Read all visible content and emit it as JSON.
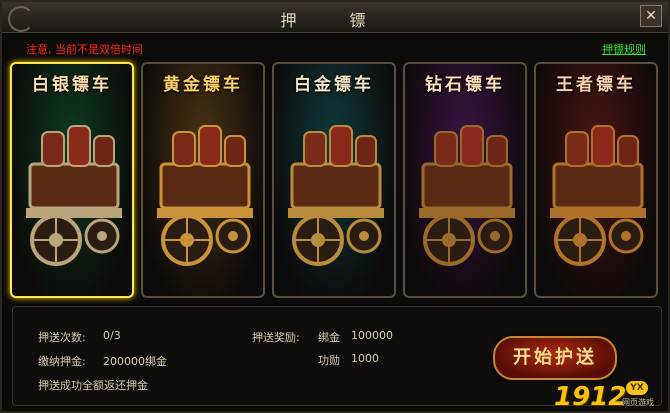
{
  "window": {
    "title": "押  镖",
    "close_label": "✕"
  },
  "notice": "注意, 当前不是双倍时间",
  "rules_link": "押镖规则",
  "cards": [
    {
      "name": "白银镖车",
      "color": "#ffe0b0",
      "bg": "#0d3a21",
      "metal": "#b9a47c",
      "selected": true
    },
    {
      "name": "黄金镖车",
      "color": "#ffd36a",
      "bg": "#4a3315",
      "metal": "#c9923b",
      "selected": false
    },
    {
      "name": "白金镖车",
      "color": "#f2e6c6",
      "bg": "#0f3a3c",
      "metal": "#b98b3d",
      "selected": false
    },
    {
      "name": "钻石镖车",
      "color": "#ffe0b8",
      "bg": "#3a1345",
      "metal": "#9b6a2a",
      "selected": false
    },
    {
      "name": "王者镖车",
      "color": "#ffd0b0",
      "bg": "#4a1414",
      "metal": "#b0722a",
      "selected": false
    }
  ],
  "info": {
    "count_label": "押送次数:",
    "count_value": "0/3",
    "deposit_label": "缴纳押金:",
    "deposit_value": "200000绑金",
    "refund_note": "押送成功全额返还押金",
    "reward_label": "押送奖励:",
    "reward1_name": "绑金",
    "reward1_value": "100000",
    "reward2_name": "功勋",
    "reward2_value": "1000"
  },
  "start_button": "开始护送",
  "logo": {
    "number": "1912",
    "badge": "YX",
    "subtitle": "网页游戏"
  }
}
